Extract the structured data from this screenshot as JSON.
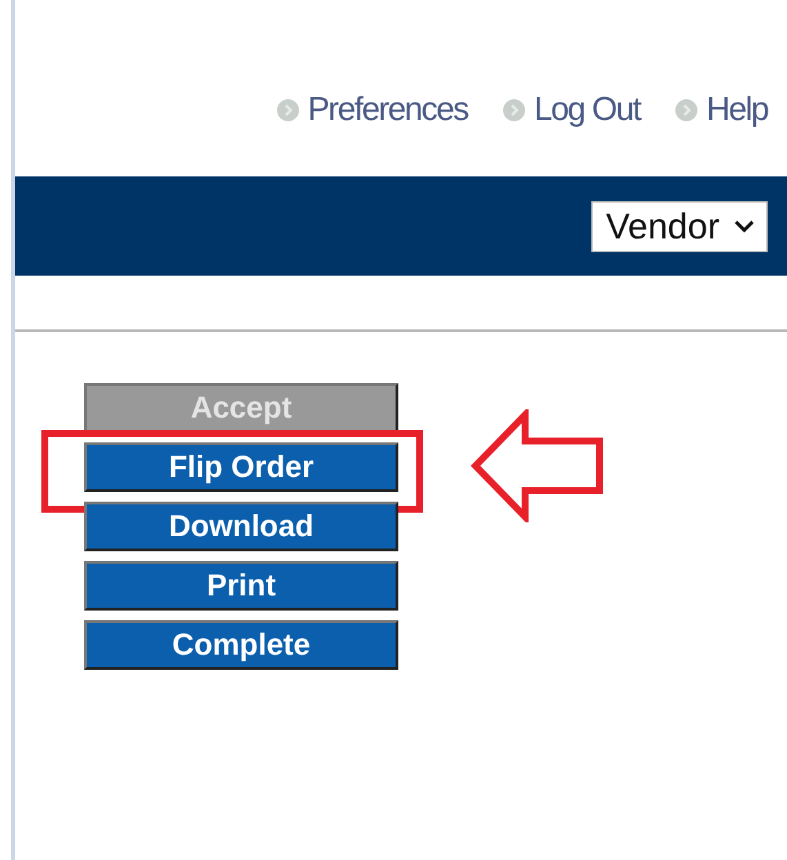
{
  "top_links": [
    "Preferences",
    "Log Out",
    "Help"
  ],
  "role_select": {
    "value": "Vendor"
  },
  "actions": [
    {
      "label": "Accept",
      "disabled": true,
      "highlighted": false
    },
    {
      "label": "Flip Order",
      "disabled": false,
      "highlighted": true
    },
    {
      "label": "Download",
      "disabled": false,
      "highlighted": false
    },
    {
      "label": "Print",
      "disabled": false,
      "highlighted": false
    },
    {
      "label": "Complete",
      "disabled": false,
      "highlighted": false
    }
  ]
}
